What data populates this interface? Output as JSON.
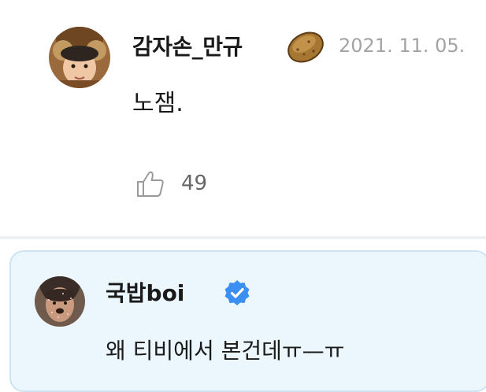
{
  "comment": {
    "author": "감자손_만규",
    "author_badge_icon": "potato-icon",
    "timestamp": "2021. 11. 05.",
    "body": "노잼.",
    "like_icon": "thumbs-up-icon",
    "like_count": "49"
  },
  "reply": {
    "author": "국밥boi",
    "author_badge_icon": "verified-icon",
    "body": "왜 티비에서 본건데ㅠ—ㅠ"
  },
  "colors": {
    "reply_background": "#ecf7fd",
    "reply_border": "#cde3f2",
    "verified_blue": "#3b8ff0",
    "timestamp_gray": "#a3a3a3"
  }
}
